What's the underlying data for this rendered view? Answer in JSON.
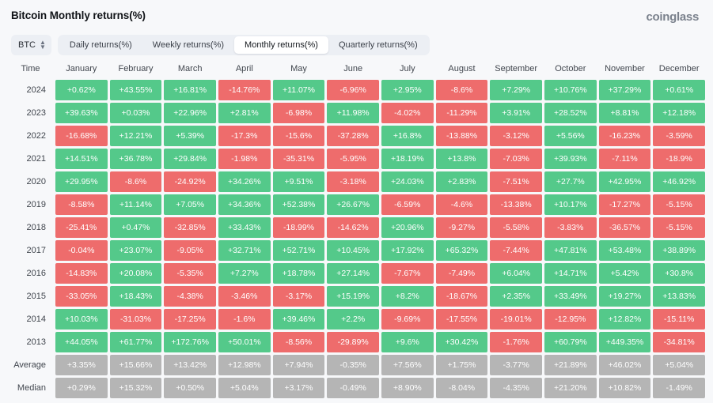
{
  "header": {
    "title": "Bitcoin Monthly returns(%)",
    "brand": "coinglass"
  },
  "toolbar": {
    "symbol": "BTC",
    "symbol_icon": "stepper-updown-icon",
    "tabs": [
      {
        "label": "Daily returns(%)",
        "active": false
      },
      {
        "label": "Weekly returns(%)",
        "active": false
      },
      {
        "label": "Monthly returns(%)",
        "active": true
      },
      {
        "label": "Quarterly returns(%)",
        "active": false
      }
    ]
  },
  "colors": {
    "positive": "#54c98a",
    "negative": "#ee6c6c",
    "stat": "#b5b5b5",
    "page_background": "#f7f8fa",
    "tabbar_background": "#eceff4"
  },
  "chart_data": {
    "type": "heatmap",
    "title": "Bitcoin Monthly returns(%)",
    "xlabel": "",
    "ylabel": "Time",
    "row_header": "Time",
    "categories": [
      "January",
      "February",
      "March",
      "April",
      "May",
      "June",
      "July",
      "August",
      "September",
      "October",
      "November",
      "December"
    ],
    "rows": [
      {
        "label": "2024",
        "kind": "year",
        "values": [
          "+0.62%",
          "+43.55%",
          "+16.81%",
          "-14.76%",
          "+11.07%",
          "-6.96%",
          "+2.95%",
          "-8.6%",
          "+7.29%",
          "+10.76%",
          "+37.29%",
          "+0.61%"
        ]
      },
      {
        "label": "2023",
        "kind": "year",
        "values": [
          "+39.63%",
          "+0.03%",
          "+22.96%",
          "+2.81%",
          "-6.98%",
          "+11.98%",
          "-4.02%",
          "-11.29%",
          "+3.91%",
          "+28.52%",
          "+8.81%",
          "+12.18%"
        ]
      },
      {
        "label": "2022",
        "kind": "year",
        "values": [
          "-16.68%",
          "+12.21%",
          "+5.39%",
          "-17.3%",
          "-15.6%",
          "-37.28%",
          "+16.8%",
          "-13.88%",
          "-3.12%",
          "+5.56%",
          "-16.23%",
          "-3.59%"
        ]
      },
      {
        "label": "2021",
        "kind": "year",
        "values": [
          "+14.51%",
          "+36.78%",
          "+29.84%",
          "-1.98%",
          "-35.31%",
          "-5.95%",
          "+18.19%",
          "+13.8%",
          "-7.03%",
          "+39.93%",
          "-7.11%",
          "-18.9%"
        ]
      },
      {
        "label": "2020",
        "kind": "year",
        "values": [
          "+29.95%",
          "-8.6%",
          "-24.92%",
          "+34.26%",
          "+9.51%",
          "-3.18%",
          "+24.03%",
          "+2.83%",
          "-7.51%",
          "+27.7%",
          "+42.95%",
          "+46.92%"
        ]
      },
      {
        "label": "2019",
        "kind": "year",
        "values": [
          "-8.58%",
          "+11.14%",
          "+7.05%",
          "+34.36%",
          "+52.38%",
          "+26.67%",
          "-6.59%",
          "-4.6%",
          "-13.38%",
          "+10.17%",
          "-17.27%",
          "-5.15%"
        ]
      },
      {
        "label": "2018",
        "kind": "year",
        "values": [
          "-25.41%",
          "+0.47%",
          "-32.85%",
          "+33.43%",
          "-18.99%",
          "-14.62%",
          "+20.96%",
          "-9.27%",
          "-5.58%",
          "-3.83%",
          "-36.57%",
          "-5.15%"
        ]
      },
      {
        "label": "2017",
        "kind": "year",
        "values": [
          "-0.04%",
          "+23.07%",
          "-9.05%",
          "+32.71%",
          "+52.71%",
          "+10.45%",
          "+17.92%",
          "+65.32%",
          "-7.44%",
          "+47.81%",
          "+53.48%",
          "+38.89%"
        ]
      },
      {
        "label": "2016",
        "kind": "year",
        "values": [
          "-14.83%",
          "+20.08%",
          "-5.35%",
          "+7.27%",
          "+18.78%",
          "+27.14%",
          "-7.67%",
          "-7.49%",
          "+6.04%",
          "+14.71%",
          "+5.42%",
          "+30.8%"
        ]
      },
      {
        "label": "2015",
        "kind": "year",
        "values": [
          "-33.05%",
          "+18.43%",
          "-4.38%",
          "-3.46%",
          "-3.17%",
          "+15.19%",
          "+8.2%",
          "-18.67%",
          "+2.35%",
          "+33.49%",
          "+19.27%",
          "+13.83%"
        ]
      },
      {
        "label": "2014",
        "kind": "year",
        "values": [
          "+10.03%",
          "-31.03%",
          "-17.25%",
          "-1.6%",
          "+39.46%",
          "+2.2%",
          "-9.69%",
          "-17.55%",
          "-19.01%",
          "-12.95%",
          "+12.82%",
          "-15.11%"
        ]
      },
      {
        "label": "2013",
        "kind": "year",
        "values": [
          "+44.05%",
          "+61.77%",
          "+172.76%",
          "+50.01%",
          "-8.56%",
          "-29.89%",
          "+9.6%",
          "+30.42%",
          "-1.76%",
          "+60.79%",
          "+449.35%",
          "-34.81%"
        ]
      },
      {
        "label": "Average",
        "kind": "stat",
        "values": [
          "+3.35%",
          "+15.66%",
          "+13.42%",
          "+12.98%",
          "+7.94%",
          "-0.35%",
          "+7.56%",
          "+1.75%",
          "-3.77%",
          "+21.89%",
          "+46.02%",
          "+5.04%"
        ]
      },
      {
        "label": "Median",
        "kind": "stat",
        "values": [
          "+0.29%",
          "+15.32%",
          "+0.50%",
          "+5.04%",
          "+3.17%",
          "-0.49%",
          "+8.90%",
          "-8.04%",
          "-4.35%",
          "+21.20%",
          "+10.82%",
          "-1.49%"
        ]
      }
    ]
  }
}
